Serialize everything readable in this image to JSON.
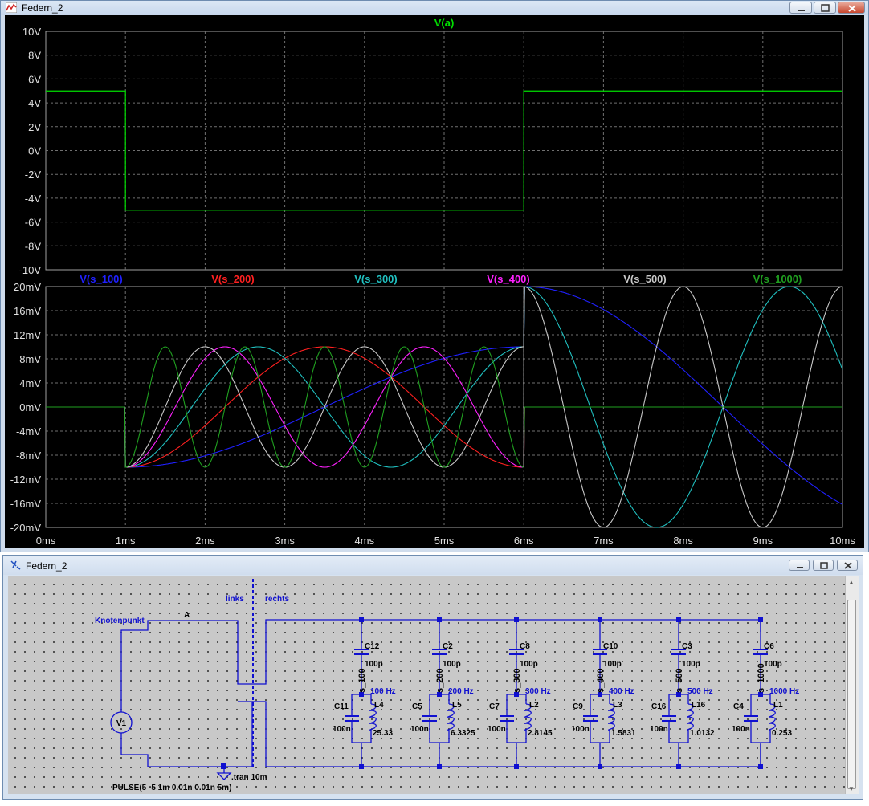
{
  "waveform_window": {
    "title": "Federn_2",
    "top_pane": {
      "trace_label": "V(a)",
      "y_ticks": [
        "10V",
        "8V",
        "6V",
        "4V",
        "2V",
        "0V",
        "-2V",
        "-4V",
        "-6V",
        "-8V",
        "-10V"
      ]
    },
    "bottom_pane": {
      "trace_labels": [
        "V(s_100)",
        "V(s_200)",
        "V(s_300)",
        "V(s_400)",
        "V(s_500)",
        "V(s_1000)"
      ],
      "y_ticks": [
        "20mV",
        "16mV",
        "12mV",
        "8mV",
        "4mV",
        "0mV",
        "-4mV",
        "-8mV",
        "-12mV",
        "-16mV",
        "-20mV"
      ]
    },
    "x_ticks": [
      "0ms",
      "1ms",
      "2ms",
      "3ms",
      "4ms",
      "5ms",
      "6ms",
      "7ms",
      "8ms",
      "9ms",
      "10ms"
    ]
  },
  "chart_data": [
    {
      "type": "line",
      "series": [
        {
          "name": "V(a)",
          "color": "#00e000",
          "x_ms": [
            0,
            1,
            1,
            6,
            6,
            10
          ],
          "y_V": [
            5,
            5,
            -5,
            -5,
            5,
            5
          ]
        }
      ],
      "x_unit": "ms",
      "xlim": [
        0,
        10
      ],
      "ylim": [
        -10,
        10
      ],
      "y_unit": "V",
      "grid": true
    },
    {
      "type": "line",
      "series": [
        {
          "name": "V(s_100)",
          "color": "#2020ff",
          "frequency_hz": 100
        },
        {
          "name": "V(s_200)",
          "color": "#ff2020",
          "frequency_hz": 200
        },
        {
          "name": "V(s_300)",
          "color": "#20c0c0",
          "frequency_hz": 300
        },
        {
          "name": "V(s_400)",
          "color": "#ff20ff",
          "frequency_hz": 400
        },
        {
          "name": "V(s_500)",
          "color": "#c8c8c8",
          "frequency_hz": 500
        },
        {
          "name": "V(s_1000)",
          "color": "#20a020",
          "frequency_hz": 1000
        }
      ],
      "x_unit": "ms",
      "xlim": [
        0,
        10
      ],
      "ylim": [
        -20,
        20
      ],
      "y_unit": "mV",
      "grid": true
    }
  ],
  "schematic_window": {
    "title": "Federn_2",
    "labels": {
      "knotenpunkt": "Knotenpunkt",
      "node_a": "A",
      "links": "links",
      "rechts": "rechts",
      "source": "V1",
      "pulse": "PULSE(5 -5 1m 0.01n 0.01n 5m)",
      "tran": ".tran 10m"
    },
    "branches": [
      {
        "node": "s_100",
        "cap_top": "C12",
        "cap_top_val": "100p",
        "freq": "100 Hz",
        "cap": "C11",
        "cap_val": "100n",
        "ind": "L4",
        "ind_val": "25.33"
      },
      {
        "node": "s_200",
        "cap_top": "C2",
        "cap_top_val": "100p",
        "freq": "200 Hz",
        "cap": "C5",
        "cap_val": "100n",
        "ind": "L5",
        "ind_val": "6.3325"
      },
      {
        "node": "s_300",
        "cap_top": "C8",
        "cap_top_val": "100p",
        "freq": "300 Hz",
        "cap": "C7",
        "cap_val": "100n",
        "ind": "L2",
        "ind_val": "2.8145"
      },
      {
        "node": "s_400",
        "cap_top": "C10",
        "cap_top_val": "100p",
        "freq": "400 Hz",
        "cap": "C9",
        "cap_val": "100n",
        "ind": "L3",
        "ind_val": "1.5831"
      },
      {
        "node": "s_500",
        "cap_top": "C3",
        "cap_top_val": "100p",
        "freq": "500 Hz",
        "cap": "C16",
        "cap_val": "100n",
        "ind": "L16",
        "ind_val": "1.0132"
      },
      {
        "node": "s_1000",
        "cap_top": "C6",
        "cap_top_val": "100p",
        "freq": "1000 Hz",
        "cap": "C4",
        "cap_val": "100n",
        "ind": "L1",
        "ind_val": "0.253"
      }
    ]
  }
}
